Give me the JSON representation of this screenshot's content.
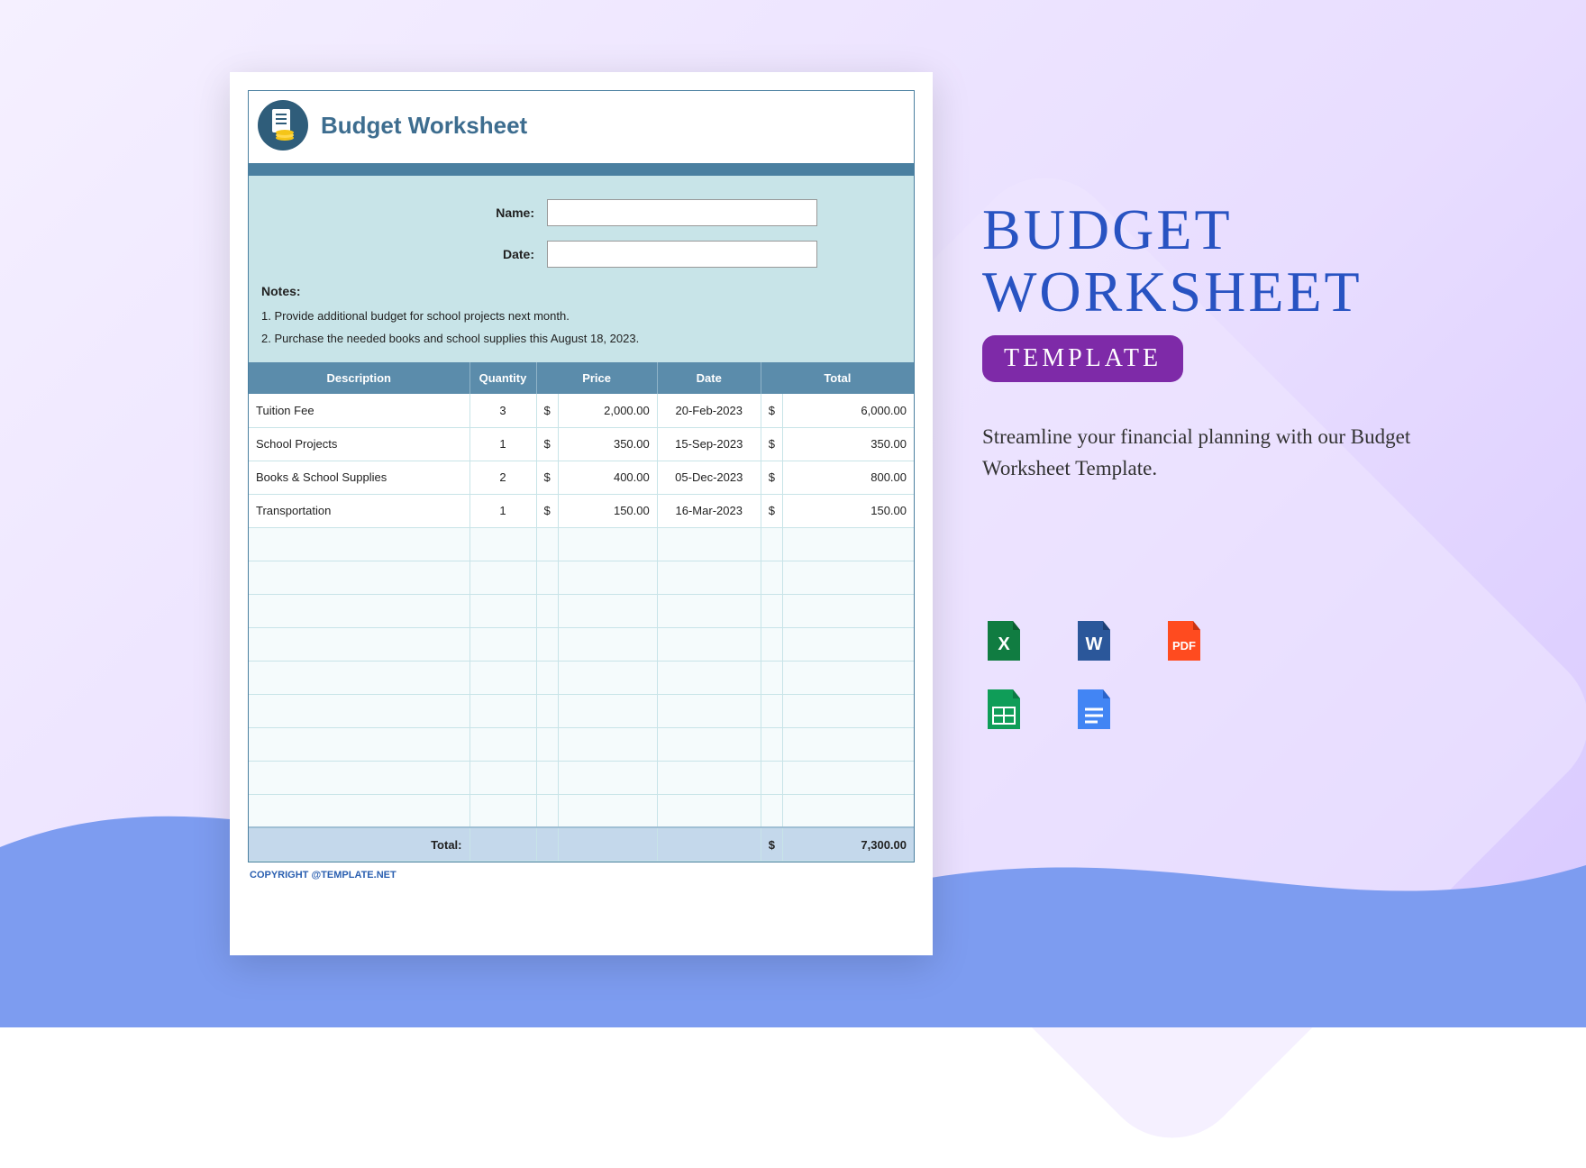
{
  "doc": {
    "title": "Budget Worksheet",
    "name_label": "Name:",
    "date_label": "Date:",
    "name_value": "",
    "date_value": "",
    "notes_label": "Notes:",
    "notes": [
      "1. Provide additional budget for school projects next month.",
      "2. Purchase the needed books and school supplies this August 18, 2023."
    ],
    "columns": {
      "description": "Description",
      "quantity": "Quantity",
      "price": "Price",
      "date": "Date",
      "total": "Total"
    },
    "rows": [
      {
        "description": "Tuition Fee",
        "quantity": "3",
        "currency": "$",
        "price": "2,000.00",
        "date": "20-Feb-2023",
        "tcurrency": "$",
        "total": "6,000.00"
      },
      {
        "description": "School Projects",
        "quantity": "1",
        "currency": "$",
        "price": "350.00",
        "date": "15-Sep-2023",
        "tcurrency": "$",
        "total": "350.00"
      },
      {
        "description": "Books & School Supplies",
        "quantity": "2",
        "currency": "$",
        "price": "400.00",
        "date": "05-Dec-2023",
        "tcurrency": "$",
        "total": "800.00"
      },
      {
        "description": "Transportation",
        "quantity": "1",
        "currency": "$",
        "price": "150.00",
        "date": "16-Mar-2023",
        "tcurrency": "$",
        "total": "150.00"
      }
    ],
    "empty_rows": 9,
    "total_label": "Total:",
    "total_currency": "$",
    "grand_total": "7,300.00",
    "copyright": "COPYRIGHT @TEMPLATE.NET"
  },
  "promo": {
    "line1": "BUDGET",
    "line2": "WORKSHEET",
    "badge": "TEMPLATE",
    "subtitle": "Streamline your financial planning with our Budget Worksheet Template."
  },
  "formats": [
    {
      "name": "excel",
      "label": "X",
      "bg": "#107c41",
      "corner": "#0b5c2f"
    },
    {
      "name": "word",
      "label": "W",
      "bg": "#2b579a",
      "corner": "#1e3f73"
    },
    {
      "name": "pdf",
      "label": "PDF",
      "bg": "#ff4b1f",
      "corner": "#c93212"
    },
    {
      "name": "google-sheets",
      "label": "",
      "bg": "#0f9d58",
      "corner": "#0b7a44"
    },
    {
      "name": "google-docs",
      "label": "",
      "bg": "#4285f4",
      "corner": "#2a63c9"
    }
  ]
}
